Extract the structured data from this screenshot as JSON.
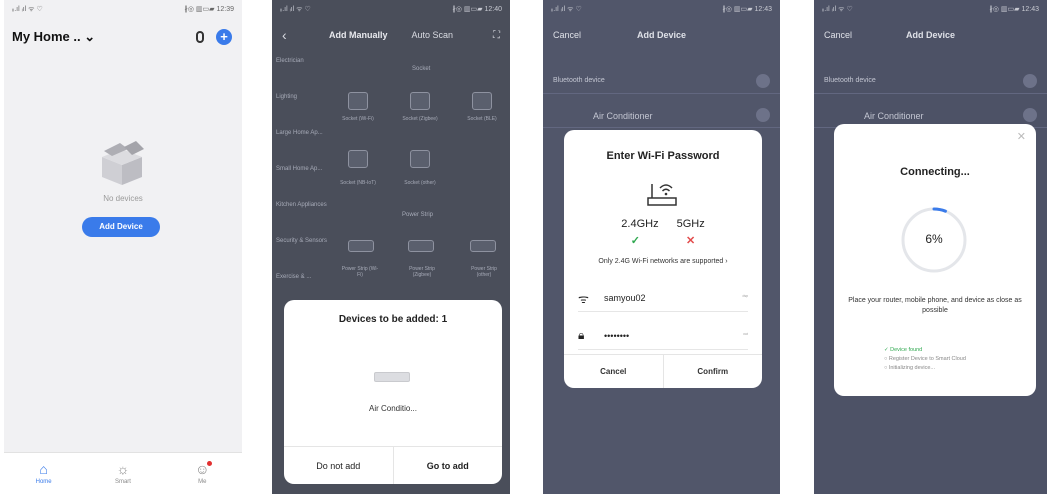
{
  "status": {
    "left": "ᵢᵢ.ıl ᵢıl ᯤ ♡",
    "p1_right": "∦◎ ▥▭▰ 12:39",
    "p2_right": "∦◎ ▥▭▰ 12:40",
    "p3_right": "∦◎ ▥▭▰ 12:43",
    "p4_right": "∦◎ ▥▭▰ 12:43"
  },
  "home": {
    "title": "My Home .. ⌄",
    "empty_text": "No devices",
    "add_button": "Add Device",
    "tabs": [
      {
        "label": "Home",
        "icon": "house-icon"
      },
      {
        "label": "Smart",
        "icon": "sun-icon"
      },
      {
        "label": "Me",
        "icon": "profile-icon"
      }
    ]
  },
  "add_manual": {
    "back": "‹",
    "tab_manual": "Add Manually",
    "tab_auto": "Auto Scan",
    "scan": "⛶",
    "categories": [
      "Electrician",
      "Lighting",
      "Large Home Ap...",
      "Small Home Ap...",
      "Kitchen Appliances",
      "Security & Sensors",
      "Exercise & ..."
    ],
    "section_socket": "Socket",
    "section_power_strip": "Power Strip",
    "items": [
      "Socket (Wi-Fi)",
      "Socket (Zigbee)",
      "Socket (BLE)",
      "Socket (NB-IoT)",
      "Socket (other)",
      "Power Strip (Wi-Fi)",
      "Power Strip (Zigbee)",
      "Power Strip (other)"
    ],
    "sheet": {
      "title": "Devices to be added: 1",
      "device_name": "Air Conditio...",
      "btn_left": "Do not add",
      "btn_right": "Go to add"
    }
  },
  "wifi": {
    "cancel": "Cancel",
    "title": "Add Device",
    "row_bt": "Bluetooth device",
    "row_ac": "Air Conditioner",
    "dialog": {
      "title": "Enter Wi-Fi Password",
      "band1": "2.4GHz",
      "band2": "5GHz",
      "note": "Only 2.4G Wi-Fi networks are supported ›",
      "ssid": "samyou02",
      "ssid_right": "ᵈˢᵖ",
      "password": "••••••••",
      "password_right": "ᵒᵘᵗ",
      "btn_left": "Cancel",
      "btn_right": "Confirm"
    }
  },
  "connect": {
    "cancel": "Cancel",
    "title": "Add Device",
    "row_bt": "Bluetooth device",
    "row_ac": "Air Conditioner",
    "dialog": {
      "close": "✕",
      "title": "Connecting...",
      "progress": 0.06,
      "percent_text": "6%",
      "note": "Place your router, mobile phone, and device as close as possible",
      "steps": [
        "✓ Device found",
        "○ Register Device to Smart Cloud",
        "○ Initializing device..."
      ]
    }
  },
  "colors": {
    "accent": "#3a7bea",
    "check": "#2fa84f",
    "cross": "#e24b4b"
  }
}
